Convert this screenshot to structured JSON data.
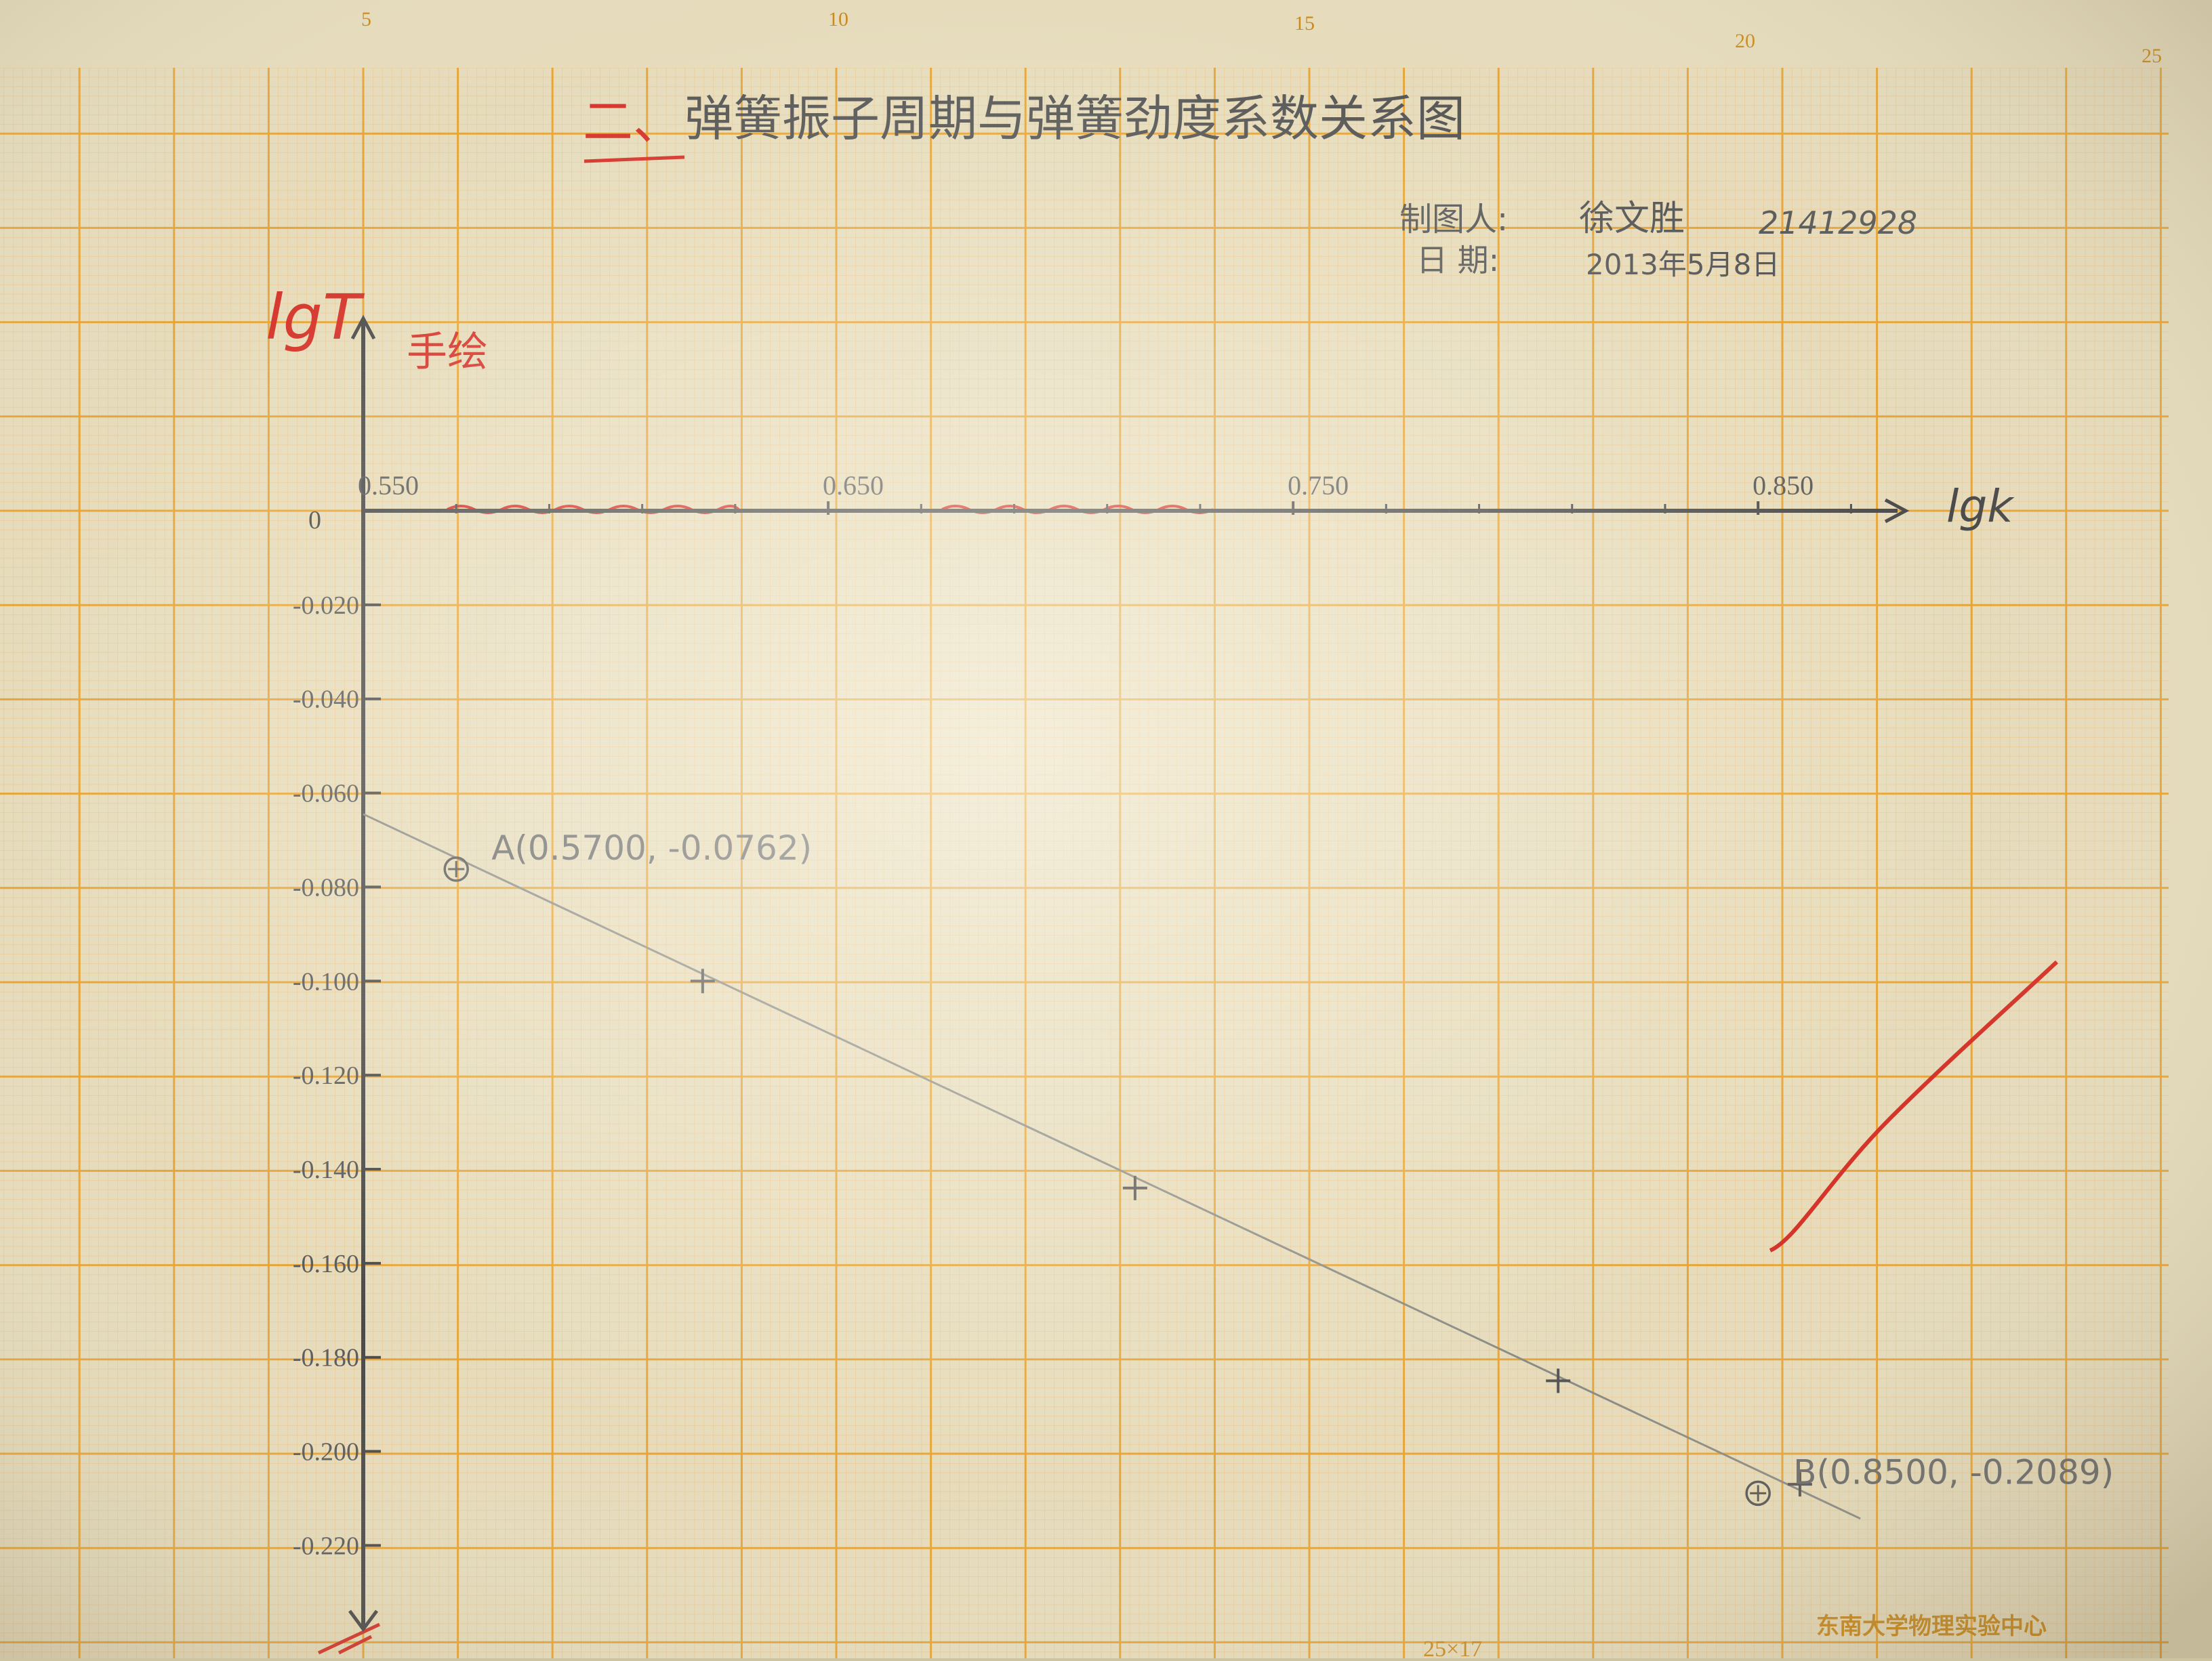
{
  "paper": {
    "ruler_top": [
      "5",
      "10",
      "15",
      "20",
      "25"
    ],
    "footer_publisher": "东南大学物理实验中心",
    "footer_size": "25×17",
    "colors": {
      "paper": "#e6dcbc",
      "grid_fine": "#ecc58a",
      "grid_major": "#e6a538",
      "pencil": "#4a4a4a",
      "red_ink": "#d43228"
    }
  },
  "heading": {
    "number": "二、",
    "title": "弹簧振子周期与弹簧劲度系数关系图"
  },
  "author": {
    "label": "制图人:",
    "name": "徐文胜",
    "student_id": "21412928"
  },
  "date": {
    "label": "日  期:",
    "value": "2013年5月8日"
  },
  "red_annotation": {
    "axis_word": "lgT",
    "note": "手绘"
  },
  "chart_data": {
    "type": "scatter",
    "title": "弹簧振子周期与弹簧劲度系数关系图",
    "xlabel": "lgk",
    "ylabel": "lgT",
    "origin_label": "0",
    "xlim": [
      0.55,
      0.88
    ],
    "ylim": [
      -0.227,
      0
    ],
    "x_ticks": [
      "0.550",
      "0.650",
      "0.750",
      "0.850"
    ],
    "y_ticks": [
      "-0.020",
      "-0.040",
      "-0.060",
      "-0.080",
      "-0.100",
      "-0.120",
      "-0.140",
      "-0.160",
      "-0.180",
      "-0.200",
      "-0.220"
    ],
    "grid": true,
    "series": [
      {
        "marker": "plus",
        "points": [
          {
            "x": 0.623,
            "y": -0.1
          },
          {
            "x": 0.716,
            "y": -0.144
          },
          {
            "x": 0.807,
            "y": -0.185
          },
          {
            "x": 0.859,
            "y": -0.207
          }
        ]
      }
    ],
    "fit_line": {
      "from": {
        "x": 0.55,
        "y": -0.0645
      },
      "to": {
        "x": 0.872,
        "y": -0.2143
      }
    },
    "marked_points": [
      {
        "name": "A",
        "label": "A(0.5700, -0.0762)",
        "x": 0.57,
        "y": -0.0762
      },
      {
        "name": "B",
        "label": "B(0.8500, -0.2089)",
        "x": 0.85,
        "y": -0.2089
      }
    ]
  }
}
